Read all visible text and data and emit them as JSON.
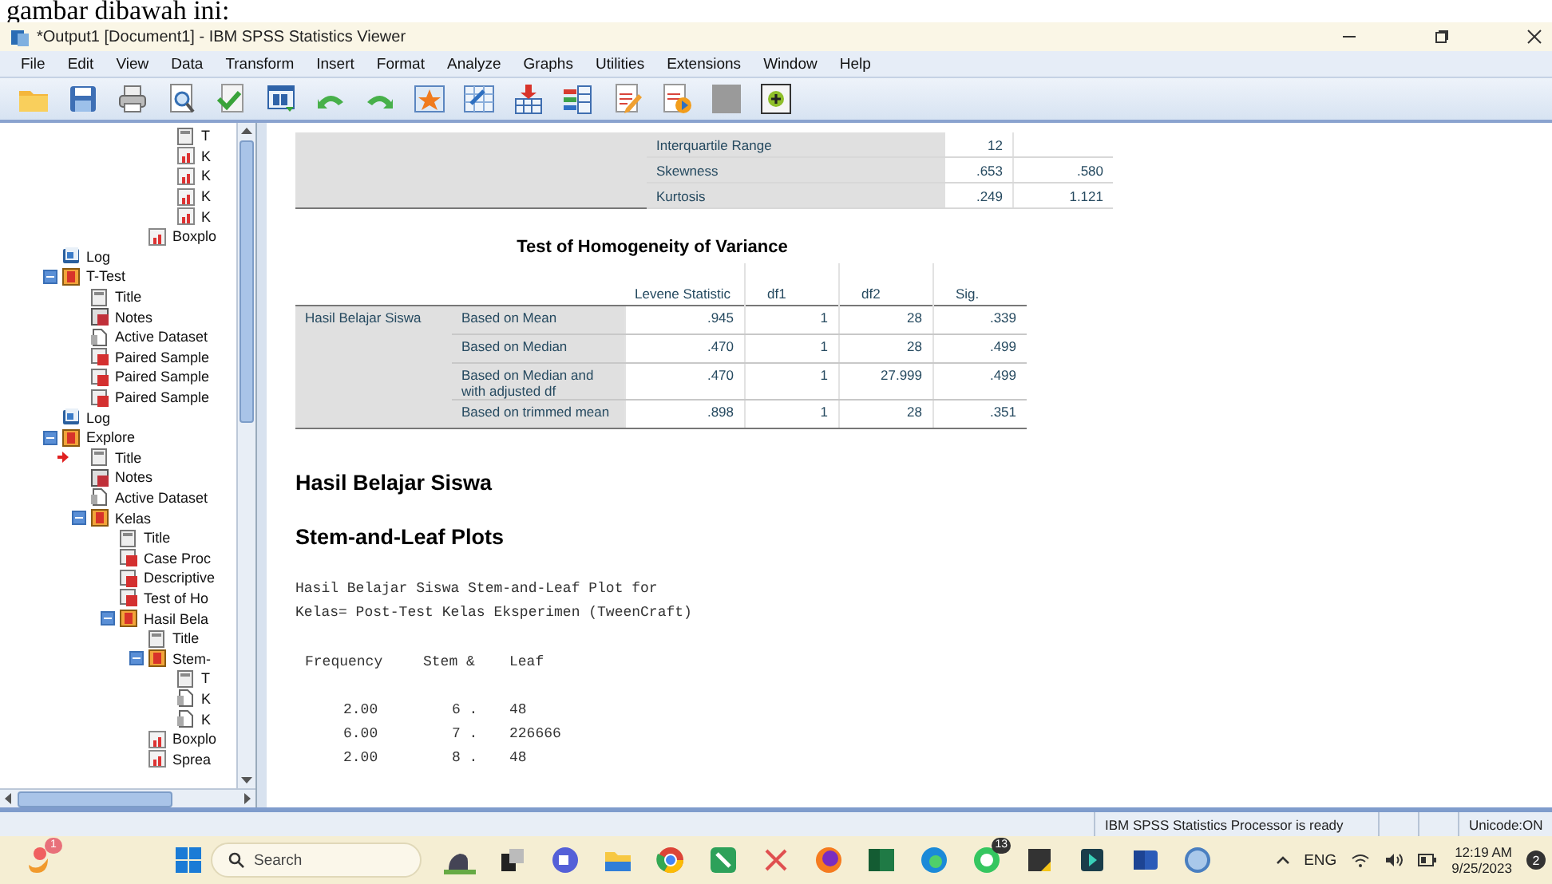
{
  "caption": "gambar dibawah ini:",
  "window": {
    "title": "*Output1 [Document1] - IBM SPSS Statistics Viewer"
  },
  "menu": [
    "File",
    "Edit",
    "View",
    "Data",
    "Transform",
    "Insert",
    "Format",
    "Analyze",
    "Graphs",
    "Utilities",
    "Extensions",
    "Window",
    "Help"
  ],
  "tree": [
    {
      "children": [
        {
          "children": [
            {
              "children": [
                {
                  "children": [
                    {
                      "label": "T",
                      "kind": "title",
                      "current": false
                    },
                    {
                      "label": "K",
                      "kind": "chart",
                      "current": false
                    },
                    {
                      "label": "K",
                      "kind": "chart",
                      "current": false
                    },
                    {
                      "label": "K",
                      "kind": "chart",
                      "current": false
                    },
                    {
                      "label": "K",
                      "kind": "chart",
                      "current": false
                    }
                  ]
                },
                {
                  "label": "Boxplo",
                  "kind": "chart",
                  "current": false
                }
              ]
            }
          ]
        }
      ]
    },
    {
      "label": "Log",
      "kind": "log",
      "current": false
    },
    {
      "label": "T-Test",
      "kind": "section",
      "current": false,
      "expanded": true,
      "children": [
        {
          "label": "Title",
          "kind": "title",
          "current": false
        },
        {
          "label": "Notes",
          "kind": "notes",
          "current": false
        },
        {
          "label": "Active Dataset",
          "kind": "dataset",
          "current": false
        },
        {
          "label": "Paired Sample",
          "kind": "table",
          "current": false
        },
        {
          "label": "Paired Sample",
          "kind": "table",
          "current": false
        },
        {
          "label": "Paired Sample",
          "kind": "table",
          "current": false
        }
      ]
    },
    {
      "label": "Log",
      "kind": "log",
      "current": false
    },
    {
      "label": "Explore",
      "kind": "section",
      "current": false,
      "expanded": true,
      "children": [
        {
          "label": "Title",
          "kind": "title",
          "current": true
        },
        {
          "label": "Notes",
          "kind": "notes",
          "current": false
        },
        {
          "label": "Active Dataset",
          "kind": "dataset",
          "current": false
        },
        {
          "label": "Kelas",
          "kind": "section",
          "current": false,
          "expanded": true,
          "children": [
            {
              "label": "Title",
              "kind": "title",
              "current": false
            },
            {
              "label": "Case Proc",
              "kind": "table",
              "current": false
            },
            {
              "label": "Descriptive",
              "kind": "table",
              "current": false
            },
            {
              "label": "Test of Ho",
              "kind": "table",
              "current": false
            },
            {
              "label": "Hasil Bela",
              "kind": "section",
              "current": false,
              "expanded": true,
              "children": [
                {
                  "label": "Title",
                  "kind": "title",
                  "current": false
                },
                {
                  "label": "Stem-",
                  "kind": "section",
                  "current": false,
                  "expanded": true,
                  "children": [
                    {
                      "label": "T",
                      "kind": "title",
                      "current": false
                    },
                    {
                      "label": "K",
                      "kind": "dataset",
                      "current": false
                    },
                    {
                      "label": "K",
                      "kind": "dataset",
                      "current": false
                    }
                  ]
                },
                {
                  "label": "Boxplo",
                  "kind": "chart",
                  "current": false
                },
                {
                  "label": "Sprea",
                  "kind": "chart",
                  "current": false
                }
              ]
            }
          ]
        }
      ]
    }
  ],
  "descriptives_table": {
    "rows": [
      {
        "label": "Interquartile Range",
        "statistic": "12"
      },
      {
        "label": "Skewness",
        "statistic": ".653",
        "std_error": ".580"
      },
      {
        "label": "Kurtosis",
        "statistic": ".249",
        "std_error": "1.121"
      }
    ]
  },
  "homogeneity_table": {
    "title": "Test of Homogeneity of Variance",
    "columns": [
      "Levene Statistic",
      "df1",
      "df2",
      "Sig."
    ],
    "group": "Hasil Belajar Siswa",
    "rows": [
      {
        "label": "Based on Mean",
        "values": [
          ".945",
          "1",
          "28",
          ".339"
        ]
      },
      {
        "label": "Based on Median",
        "values": [
          ".470",
          "1",
          "28",
          ".499"
        ]
      },
      {
        "label": "Based on Median and with adjusted df",
        "values": [
          ".470",
          "1",
          "27.999",
          ".499"
        ]
      },
      {
        "label": "Based on trimmed mean",
        "values": [
          ".898",
          "1",
          "28",
          ".351"
        ]
      }
    ]
  },
  "heading": "Hasil Belajar Siswa",
  "subheading": "Stem-and-Leaf Plots",
  "stem_leaf": {
    "title_lines": [
      "Hasil Belajar Siswa Stem-and-Leaf Plot for",
      "Kelas= Post-Test Kelas Eksperimen (TweenCraft)"
    ],
    "columns": [
      "Frequency",
      "Stem &",
      "Leaf"
    ],
    "rows": [
      {
        "frequency": "2.00",
        "stem": "6 .",
        "leaf": "48"
      },
      {
        "frequency": "6.00",
        "stem": "7 .",
        "leaf": "226666"
      },
      {
        "frequency": "2.00",
        "stem": "8 .",
        "leaf": "48"
      }
    ]
  },
  "status_bar": {
    "message": "IBM SPSS Statistics Processor is ready",
    "encoding": "Unicode:ON"
  },
  "taskbar": {
    "search_placeholder": "Search",
    "widget_badge": "1",
    "chat_badge": "13",
    "language": "ENG",
    "time": "12:19 AM",
    "date": "9/25/2023",
    "notification_count": "2"
  }
}
